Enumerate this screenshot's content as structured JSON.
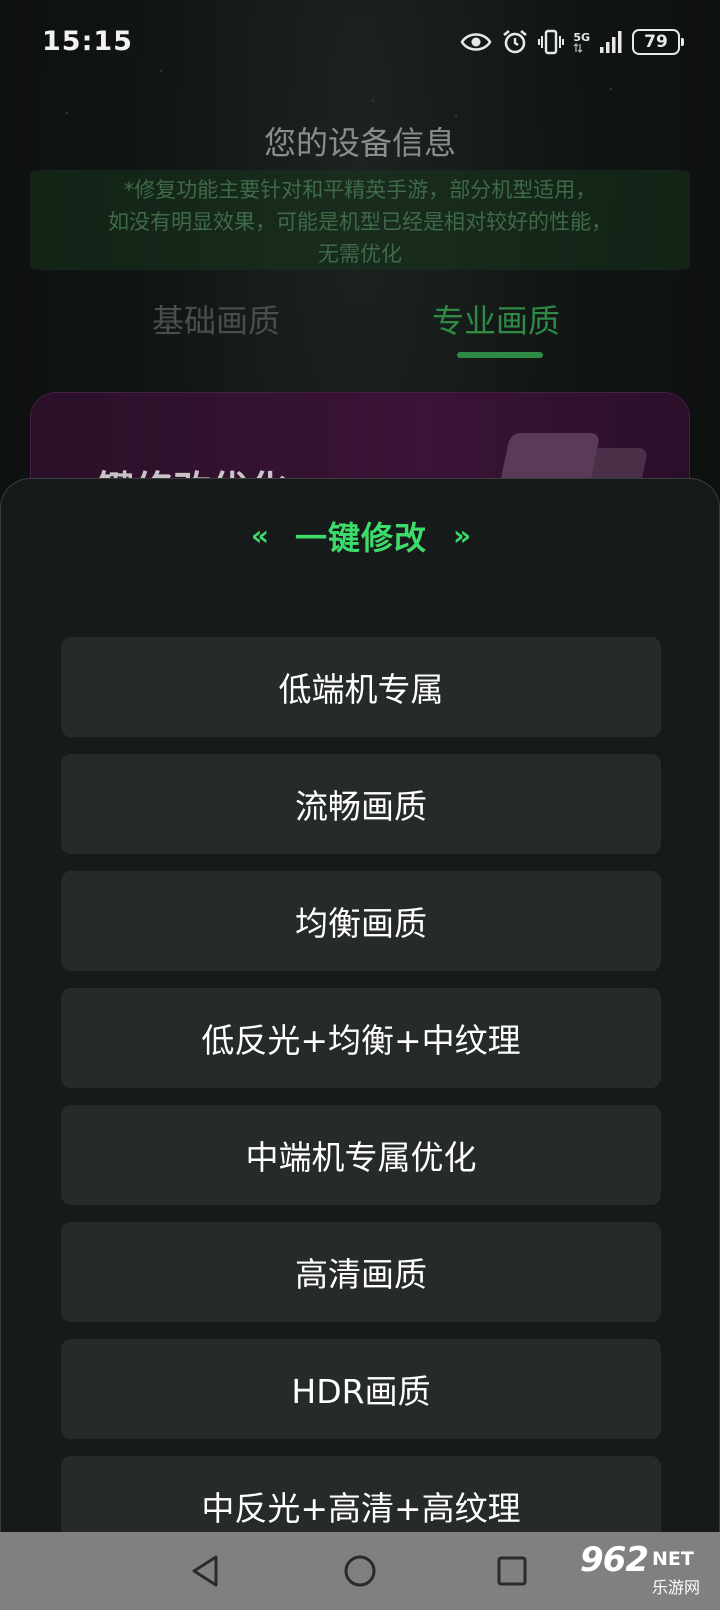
{
  "status_bar": {
    "time": "15:15",
    "network": "5G",
    "battery": "79"
  },
  "background": {
    "device_title": "您的设备信息",
    "notice_lines": [
      "*修复功能主要针对和平精英手游，部分机型适用，",
      "如没有明显效果，可能是机型已经是相对较好的性能，",
      "无需优化"
    ],
    "tabs": [
      "基础画质",
      "专业画质"
    ],
    "active_tab": "专业画质",
    "promo_title": "一键修改优化"
  },
  "sheet": {
    "title": "一键修改",
    "left_chevron": "«",
    "right_chevron": "»",
    "options": [
      "低端机专属",
      "流畅画质",
      "均衡画质",
      "低反光+均衡+中纹理",
      "中端机专属优化",
      "高清画质",
      "HDR画质",
      "中反光+高清+高纹理"
    ]
  },
  "watermark": {
    "main": "962",
    "net": "NET",
    "sub": "乐游网"
  },
  "colors": {
    "accent_green": "#3ddc6a",
    "tab_active": "#2e8a45",
    "option_bg": "#262a2b",
    "sheet_bg": "#171a1b"
  }
}
